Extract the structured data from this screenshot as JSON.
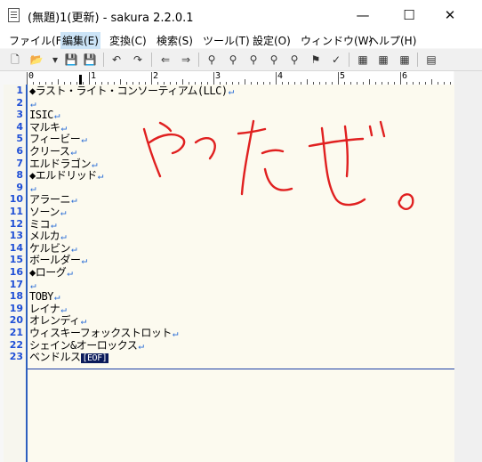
{
  "window": {
    "title": "(無題)1(更新) - sakura 2.2.0.1",
    "minimize_symbol": "—",
    "maximize_symbol": "☐",
    "close_symbol": "✕"
  },
  "menu": [
    {
      "label": "ファイル(F)",
      "name": "menu-file"
    },
    {
      "label": "編集(E)",
      "name": "menu-edit"
    },
    {
      "label": "変換(C)",
      "name": "menu-convert"
    },
    {
      "label": "検索(S)",
      "name": "menu-search"
    },
    {
      "label": "ツール(T)",
      "name": "menu-tools"
    },
    {
      "label": "設定(O)",
      "name": "menu-settings"
    },
    {
      "label": "ウィンドウ(W)",
      "name": "menu-window"
    },
    {
      "label": "ヘルプ(H)",
      "name": "menu-help"
    }
  ],
  "toolbar": [
    {
      "icon": "new-file-icon",
      "glyph": "🗋"
    },
    {
      "icon": "open-folder-icon",
      "glyph": "📂"
    },
    {
      "icon": "dropdown-arrow-icon",
      "glyph": "▾"
    },
    {
      "icon": "save-icon",
      "glyph": "💾"
    },
    {
      "icon": "save-all-icon",
      "glyph": "💾"
    },
    {
      "icon": "undo-icon",
      "glyph": "↶"
    },
    {
      "icon": "redo-icon",
      "glyph": "↷"
    },
    {
      "icon": "back-icon",
      "glyph": "⇐"
    },
    {
      "icon": "forward-icon",
      "glyph": "⇒"
    },
    {
      "icon": "search-icon",
      "glyph": "⚲"
    },
    {
      "icon": "search-next-icon",
      "glyph": "⚲"
    },
    {
      "icon": "search-prev-icon",
      "glyph": "⚲"
    },
    {
      "icon": "replace-icon",
      "glyph": "⚲"
    },
    {
      "icon": "clear-icon",
      "glyph": "⚲"
    },
    {
      "icon": "bookmark-icon",
      "glyph": "⚑"
    },
    {
      "icon": "grep-icon",
      "glyph": "✓"
    },
    {
      "icon": "outline-icon",
      "glyph": "▦"
    },
    {
      "icon": "compare-icon",
      "glyph": "▦"
    },
    {
      "icon": "tag-jump-icon",
      "glyph": "▦"
    },
    {
      "icon": "settings-icon",
      "glyph": "▤"
    }
  ],
  "ruler": [
    "0",
    "1",
    "2",
    "3",
    "4",
    "5",
    "6"
  ],
  "lines": [
    {
      "n": "1",
      "text": "◆ラスト・ライト・コンソーティアム(LLC)",
      "cr": true
    },
    {
      "n": "2",
      "text": "",
      "cr": true
    },
    {
      "n": "3",
      "text": "ISIC",
      "cr": true
    },
    {
      "n": "4",
      "text": "マルキ",
      "cr": true
    },
    {
      "n": "5",
      "text": "フィービー",
      "cr": true
    },
    {
      "n": "6",
      "text": "クリース",
      "cr": true
    },
    {
      "n": "7",
      "text": "エルドラゴン",
      "cr": true
    },
    {
      "n": "8",
      "text": "◆エルドリッド",
      "cr": true
    },
    {
      "n": "9",
      "text": "",
      "cr": true
    },
    {
      "n": "10",
      "text": "アラーニ",
      "cr": true
    },
    {
      "n": "11",
      "text": "ソーン",
      "cr": true
    },
    {
      "n": "12",
      "text": "ミコ",
      "cr": true
    },
    {
      "n": "13",
      "text": "メルカ",
      "cr": true
    },
    {
      "n": "14",
      "text": "ケルビン",
      "cr": true
    },
    {
      "n": "15",
      "text": "ボールダー",
      "cr": true
    },
    {
      "n": "16",
      "text": "◆ローグ",
      "cr": true
    },
    {
      "n": "17",
      "text": "",
      "cr": true
    },
    {
      "n": "18",
      "text": "TOBY",
      "cr": true
    },
    {
      "n": "19",
      "text": "レイナ",
      "cr": true
    },
    {
      "n": "20",
      "text": "オレンディ",
      "cr": true
    },
    {
      "n": "21",
      "text": "ウィスキーフォックストロット",
      "cr": true
    },
    {
      "n": "22",
      "text": "シェイン&オーロックス",
      "cr": true
    },
    {
      "n": "23",
      "text": "ベンドルス",
      "cr": false,
      "eof": "[EOF]"
    }
  ],
  "cr_glyph": "↵",
  "handwriting": {
    "text": "やったぜ。",
    "color": "#e02020"
  }
}
